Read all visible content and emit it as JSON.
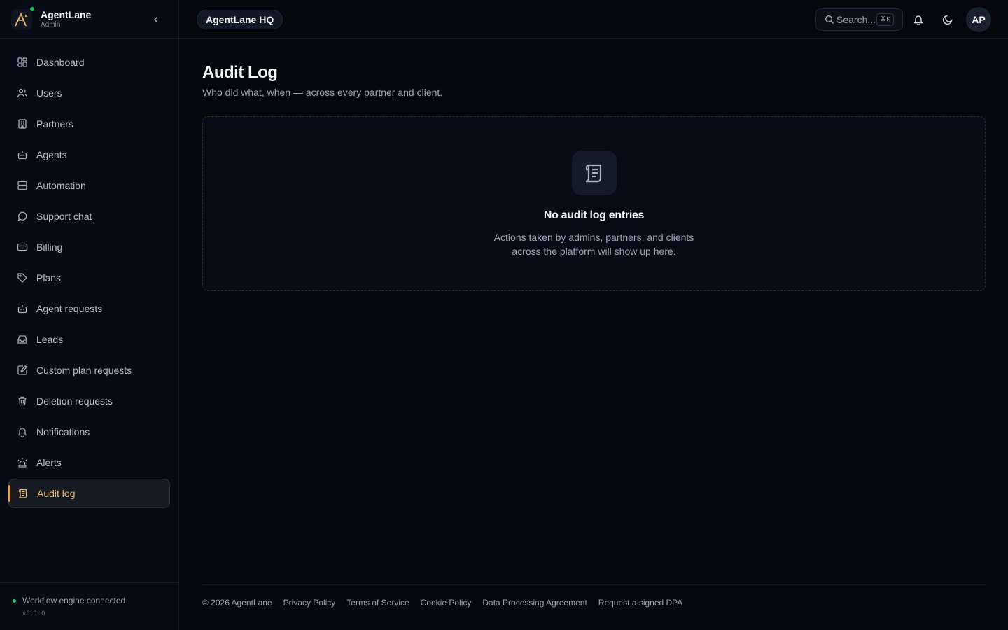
{
  "brand": {
    "name": "AgentLane",
    "role": "Admin"
  },
  "sidebar": {
    "items": [
      {
        "label": "Dashboard",
        "icon": "dashboard-icon"
      },
      {
        "label": "Users",
        "icon": "users-icon"
      },
      {
        "label": "Partners",
        "icon": "building-icon"
      },
      {
        "label": "Agents",
        "icon": "bot-icon"
      },
      {
        "label": "Automation",
        "icon": "server-icon"
      },
      {
        "label": "Support chat",
        "icon": "chat-icon"
      },
      {
        "label": "Billing",
        "icon": "credit-card-icon"
      },
      {
        "label": "Plans",
        "icon": "tag-icon"
      },
      {
        "label": "Agent requests",
        "icon": "bot-icon"
      },
      {
        "label": "Leads",
        "icon": "inbox-icon"
      },
      {
        "label": "Custom plan requests",
        "icon": "edit-icon"
      },
      {
        "label": "Deletion requests",
        "icon": "trash-icon"
      },
      {
        "label": "Notifications",
        "icon": "bell-icon"
      },
      {
        "label": "Alerts",
        "icon": "siren-icon"
      },
      {
        "label": "Audit log",
        "icon": "scroll-icon",
        "active": true
      }
    ],
    "status": "Workflow engine connected",
    "version": "v0.1.0"
  },
  "header": {
    "workspace": "AgentLane HQ",
    "search_placeholder": "Search...",
    "search_shortcut": "⌘K",
    "avatar_initials": "AP"
  },
  "main": {
    "title": "Audit Log",
    "subtitle": "Who did what, when — across every partner and client.",
    "empty_title": "No audit log entries",
    "empty_description": "Actions taken by admins, partners, and clients across the platform will show up here."
  },
  "footer": {
    "copyright": "© 2026 AgentLane",
    "links": [
      "Privacy Policy",
      "Terms of Service",
      "Cookie Policy",
      "Data Processing Agreement",
      "Request a signed DPA"
    ]
  },
  "colors": {
    "accent": "#d9a655",
    "status_ok": "#22c55e",
    "background": "#05070d"
  }
}
